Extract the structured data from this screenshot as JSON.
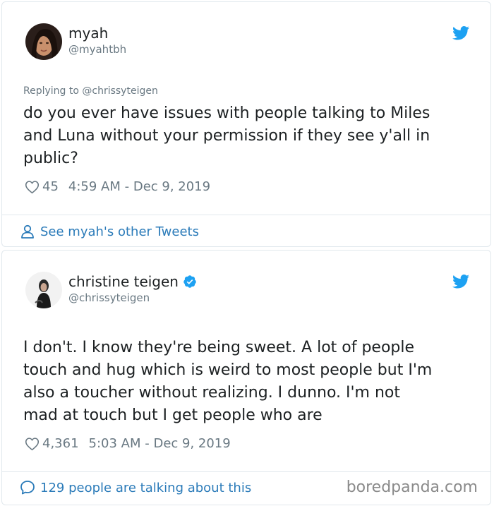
{
  "tweets": [
    {
      "author_name": "myah",
      "author_handle": "@myahtbh",
      "replying_to": "Replying to @chrissyteigen",
      "text": "do you ever have issues with people talking to Miles\nand Luna without your permission if they see y'all in\npublic?",
      "likes": "45",
      "timestamp": "4:59 AM - Dec 9, 2019",
      "footer_link": "See myah's other Tweets"
    },
    {
      "author_name": "christine teigen",
      "author_handle": "@chrissyteigen",
      "verified": true,
      "text": "I don't. I know they're being sweet. A lot of people\ntouch and hug which is weird to most people but I'm\nalso a toucher without realizing. I dunno. I'm not\nmad at touch but I get people who are",
      "likes": "4,361",
      "timestamp": "5:03 AM - Dec 9, 2019",
      "footer_link": "129 people are talking about this"
    }
  ],
  "watermark": "boredpanda.com",
  "colors": {
    "twitter_blue": "#1da1f2",
    "link_blue": "#2b7bb9",
    "muted_gray": "#697882",
    "border": "#e1e8ed",
    "text": "#1c2022"
  },
  "icons": [
    "twitter-bird-icon",
    "heart-icon",
    "person-icon",
    "speech-bubble-icon",
    "verified-badge-icon"
  ]
}
